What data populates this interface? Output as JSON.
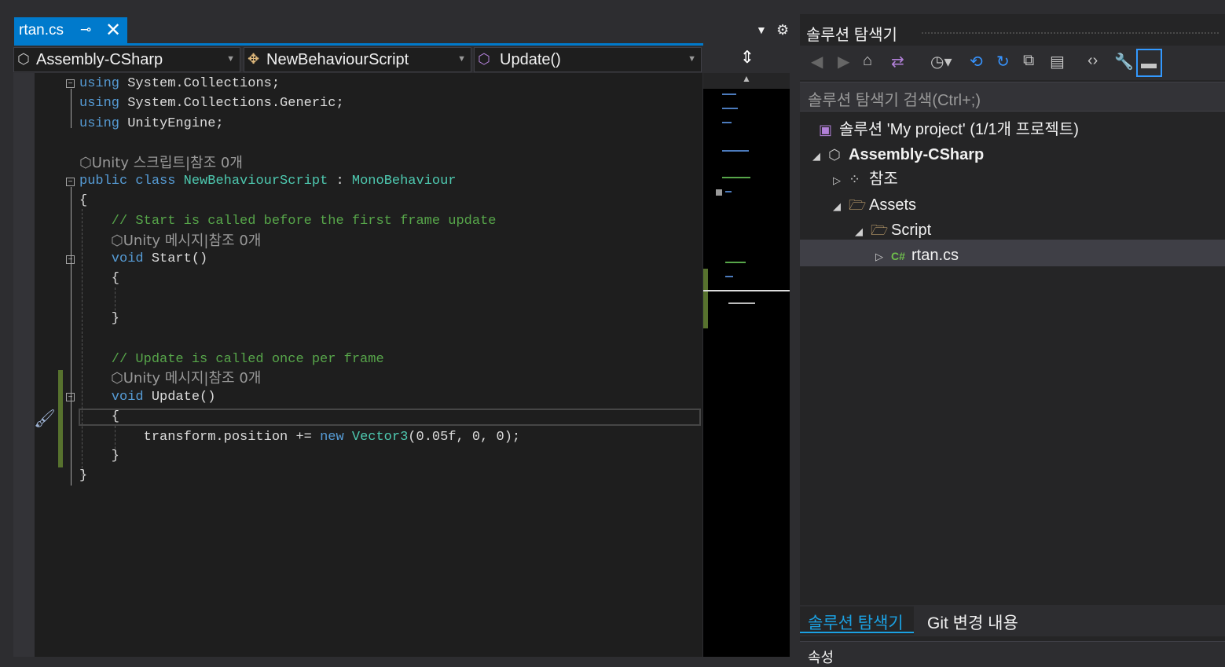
{
  "editor": {
    "tab": {
      "title": "rtan.cs",
      "pin_glyph": "⊸",
      "close_glyph": "✕"
    },
    "nav": {
      "project": "Assembly-CSharp",
      "class": "NewBehaviourScript",
      "member": "Update()"
    },
    "lines": {
      "l1_kw": "using",
      "l1_rest": " System.Collections;",
      "l2_kw": "using",
      "l2_rest": " System.Collections.Generic;",
      "l3_kw": "using",
      "l3_rest": " UnityEngine;",
      "lens_class": "Unity 스크립트|참조 0개",
      "l5_kw1": "public",
      "l5_kw2": " class",
      "l5_sp": " ",
      "l5_type": "NewBehaviourScript",
      "l5_colon": " : ",
      "l5_base": "MonoBehaviour",
      "l6": "{",
      "l7_comment": "    // Start is called before the first frame update",
      "lens_start": "Unity 메시지|참조 0개",
      "l8_kw": "    void",
      "l8_name": " Start()",
      "l9": "    {",
      "l10": "    }",
      "l11_comment": "    // Update is called once per frame",
      "lens_update": "Unity 메시지|참조 0개",
      "l12_kw": "    void",
      "l12_name": " Update()",
      "l13": "    {",
      "l14_a": "        transform.position += ",
      "l14_kw": "new",
      "l14_sp": " ",
      "l14_type": "Vector3",
      "l14_b": "(0.05f, 0, 0);",
      "l15": "    }",
      "l16": "}"
    }
  },
  "solution_explorer": {
    "title": "솔루션 탐색기",
    "search_placeholder": "솔루션 탐색기 검색(Ctrl+;)",
    "tree": [
      {
        "label": "솔루션 'My project' (1/1개 프로젝트)"
      },
      {
        "label": "Assembly-CSharp"
      },
      {
        "label": "참조"
      },
      {
        "label": "Assets"
      },
      {
        "label": "Script"
      },
      {
        "label": "rtan.cs"
      }
    ],
    "bottom_tabs": [
      "솔루션 탐색기",
      "Git 변경 내용"
    ],
    "properties_title": "속성"
  },
  "colors": {
    "accent": "#007acc",
    "keyword": "#569cd6",
    "type": "#4ec9b0",
    "comment": "#57a64a"
  }
}
